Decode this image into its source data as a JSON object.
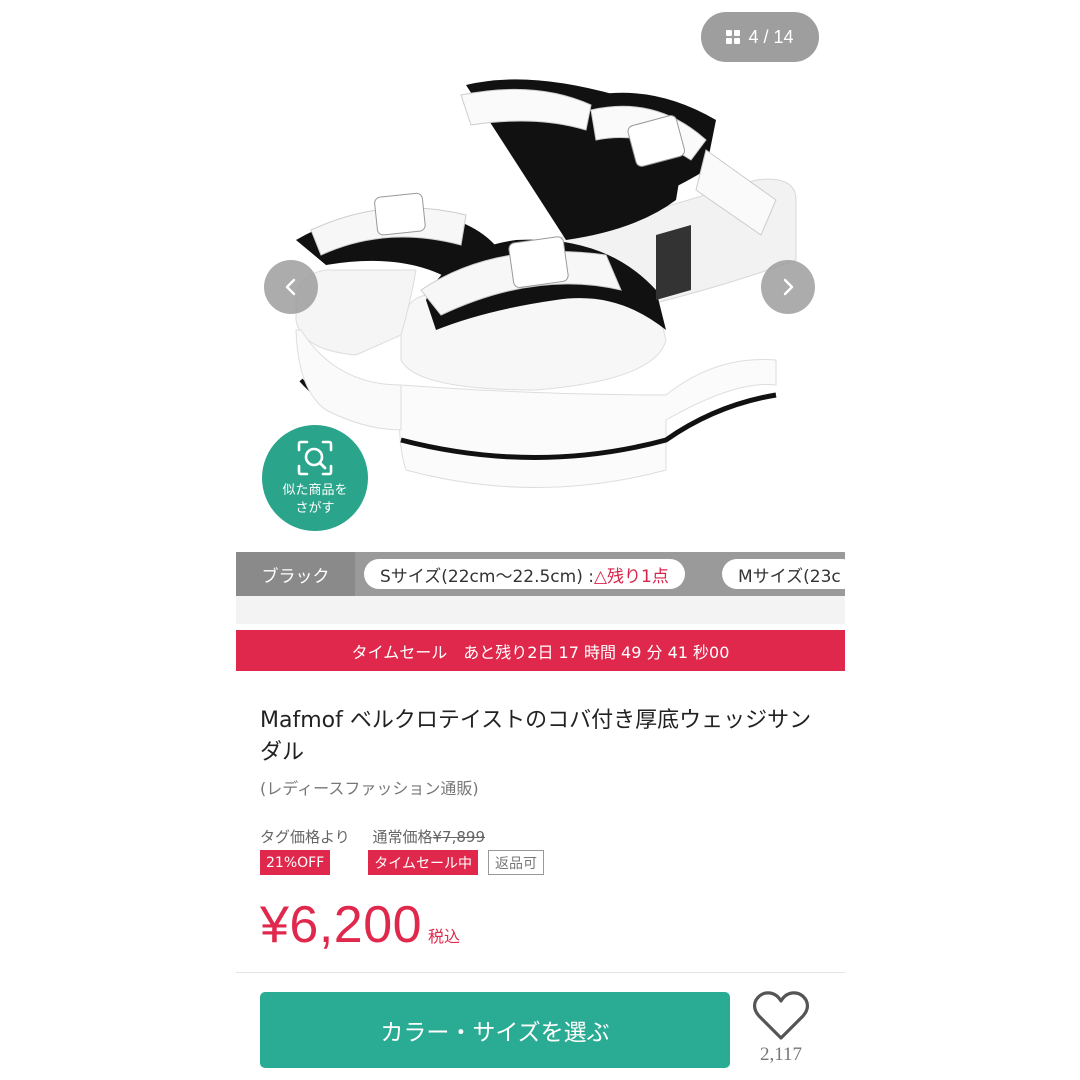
{
  "gallery": {
    "counter": "4 / 14",
    "similar_search_line1": "似た商品を",
    "similar_search_line2": "さがす"
  },
  "variants": {
    "color": "ブラック",
    "sizes": [
      {
        "label": "Sサイズ(22cm〜22.5cm) : ",
        "stock": "△残り1点"
      },
      {
        "label": "Mサイズ(23c",
        "stock": ""
      }
    ]
  },
  "timesale": {
    "banner": "タイムセール　あと残り2日 17 時間 49 分 41 秒00"
  },
  "product": {
    "title": "Mafmof ベルクロテイストのコバ付き厚底ウェッジサンダル",
    "subtitle": "(レディースファッション通販)"
  },
  "pricing": {
    "tag_label": "タグ価格より",
    "regular_label": "通常価格",
    "regular_price": "¥7,899",
    "discount_badge": "21%OFF",
    "sale_badge": "タイムセール中",
    "returnable_badge": "返品可",
    "price": "¥6,200",
    "tax_label": "税込"
  },
  "actions": {
    "select_button": "カラー・サイズを選ぶ",
    "favorite_count": "2,117"
  },
  "colors": {
    "accent_red": "#e0284c",
    "accent_green": "#2aab93",
    "chip_gray": "#9e9e9e"
  }
}
